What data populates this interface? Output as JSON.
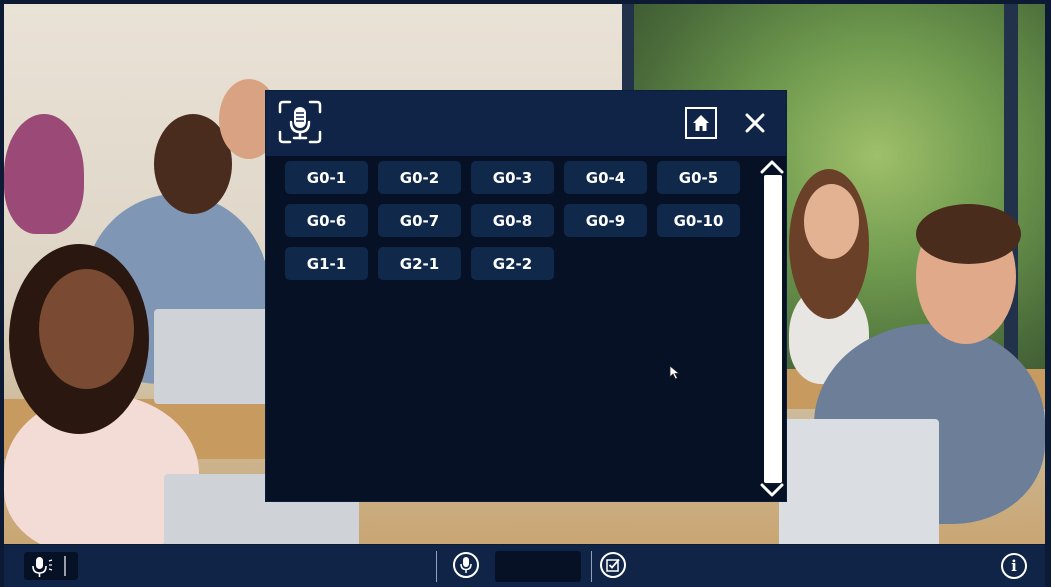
{
  "popup": {
    "mic_icon": "microphone-scan-icon",
    "home_icon": "home-icon",
    "close_icon": "close-icon",
    "group_buttons": [
      {
        "label": "G0-1"
      },
      {
        "label": "G0-2"
      },
      {
        "label": "G0-3"
      },
      {
        "label": "G0-4"
      },
      {
        "label": "G0-5"
      },
      {
        "label": "G0-6"
      },
      {
        "label": "G0-7"
      },
      {
        "label": "G0-8"
      },
      {
        "label": "G0-9"
      },
      {
        "label": "G0-10"
      },
      {
        "label": "G1-1"
      },
      {
        "label": "G2-1"
      },
      {
        "label": "G2-2"
      }
    ],
    "scroll_up_icon": "chevron-up-icon",
    "scroll_down_icon": "chevron-down-icon"
  },
  "bottombar": {
    "mic_status_icon": "microphone-active-icon",
    "mic_button_icon": "microphone-icon",
    "checklist_icon": "checkbox-icon",
    "info_icon": "info-icon",
    "info_label": "i"
  },
  "colors": {
    "popup_bg": "#061125",
    "header_bg": "#0f2446",
    "button_bg": "#10284a",
    "text": "#ffffff"
  }
}
